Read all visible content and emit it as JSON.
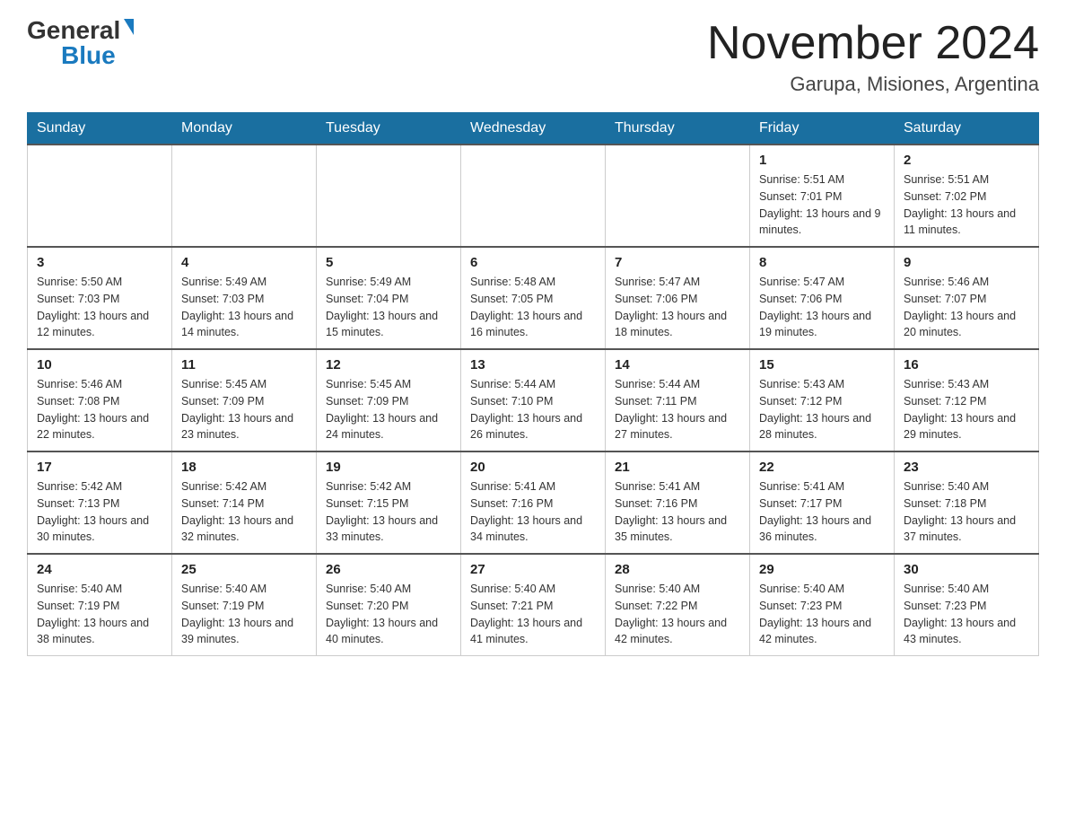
{
  "header": {
    "logo_general": "General",
    "logo_blue": "Blue",
    "month_title": "November 2024",
    "location": "Garupa, Misiones, Argentina"
  },
  "days_of_week": [
    "Sunday",
    "Monday",
    "Tuesday",
    "Wednesday",
    "Thursday",
    "Friday",
    "Saturday"
  ],
  "weeks": [
    [
      {
        "day": "",
        "info": ""
      },
      {
        "day": "",
        "info": ""
      },
      {
        "day": "",
        "info": ""
      },
      {
        "day": "",
        "info": ""
      },
      {
        "day": "",
        "info": ""
      },
      {
        "day": "1",
        "info": "Sunrise: 5:51 AM\nSunset: 7:01 PM\nDaylight: 13 hours and 9 minutes."
      },
      {
        "day": "2",
        "info": "Sunrise: 5:51 AM\nSunset: 7:02 PM\nDaylight: 13 hours and 11 minutes."
      }
    ],
    [
      {
        "day": "3",
        "info": "Sunrise: 5:50 AM\nSunset: 7:03 PM\nDaylight: 13 hours and 12 minutes."
      },
      {
        "day": "4",
        "info": "Sunrise: 5:49 AM\nSunset: 7:03 PM\nDaylight: 13 hours and 14 minutes."
      },
      {
        "day": "5",
        "info": "Sunrise: 5:49 AM\nSunset: 7:04 PM\nDaylight: 13 hours and 15 minutes."
      },
      {
        "day": "6",
        "info": "Sunrise: 5:48 AM\nSunset: 7:05 PM\nDaylight: 13 hours and 16 minutes."
      },
      {
        "day": "7",
        "info": "Sunrise: 5:47 AM\nSunset: 7:06 PM\nDaylight: 13 hours and 18 minutes."
      },
      {
        "day": "8",
        "info": "Sunrise: 5:47 AM\nSunset: 7:06 PM\nDaylight: 13 hours and 19 minutes."
      },
      {
        "day": "9",
        "info": "Sunrise: 5:46 AM\nSunset: 7:07 PM\nDaylight: 13 hours and 20 minutes."
      }
    ],
    [
      {
        "day": "10",
        "info": "Sunrise: 5:46 AM\nSunset: 7:08 PM\nDaylight: 13 hours and 22 minutes."
      },
      {
        "day": "11",
        "info": "Sunrise: 5:45 AM\nSunset: 7:09 PM\nDaylight: 13 hours and 23 minutes."
      },
      {
        "day": "12",
        "info": "Sunrise: 5:45 AM\nSunset: 7:09 PM\nDaylight: 13 hours and 24 minutes."
      },
      {
        "day": "13",
        "info": "Sunrise: 5:44 AM\nSunset: 7:10 PM\nDaylight: 13 hours and 26 minutes."
      },
      {
        "day": "14",
        "info": "Sunrise: 5:44 AM\nSunset: 7:11 PM\nDaylight: 13 hours and 27 minutes."
      },
      {
        "day": "15",
        "info": "Sunrise: 5:43 AM\nSunset: 7:12 PM\nDaylight: 13 hours and 28 minutes."
      },
      {
        "day": "16",
        "info": "Sunrise: 5:43 AM\nSunset: 7:12 PM\nDaylight: 13 hours and 29 minutes."
      }
    ],
    [
      {
        "day": "17",
        "info": "Sunrise: 5:42 AM\nSunset: 7:13 PM\nDaylight: 13 hours and 30 minutes."
      },
      {
        "day": "18",
        "info": "Sunrise: 5:42 AM\nSunset: 7:14 PM\nDaylight: 13 hours and 32 minutes."
      },
      {
        "day": "19",
        "info": "Sunrise: 5:42 AM\nSunset: 7:15 PM\nDaylight: 13 hours and 33 minutes."
      },
      {
        "day": "20",
        "info": "Sunrise: 5:41 AM\nSunset: 7:16 PM\nDaylight: 13 hours and 34 minutes."
      },
      {
        "day": "21",
        "info": "Sunrise: 5:41 AM\nSunset: 7:16 PM\nDaylight: 13 hours and 35 minutes."
      },
      {
        "day": "22",
        "info": "Sunrise: 5:41 AM\nSunset: 7:17 PM\nDaylight: 13 hours and 36 minutes."
      },
      {
        "day": "23",
        "info": "Sunrise: 5:40 AM\nSunset: 7:18 PM\nDaylight: 13 hours and 37 minutes."
      }
    ],
    [
      {
        "day": "24",
        "info": "Sunrise: 5:40 AM\nSunset: 7:19 PM\nDaylight: 13 hours and 38 minutes."
      },
      {
        "day": "25",
        "info": "Sunrise: 5:40 AM\nSunset: 7:19 PM\nDaylight: 13 hours and 39 minutes."
      },
      {
        "day": "26",
        "info": "Sunrise: 5:40 AM\nSunset: 7:20 PM\nDaylight: 13 hours and 40 minutes."
      },
      {
        "day": "27",
        "info": "Sunrise: 5:40 AM\nSunset: 7:21 PM\nDaylight: 13 hours and 41 minutes."
      },
      {
        "day": "28",
        "info": "Sunrise: 5:40 AM\nSunset: 7:22 PM\nDaylight: 13 hours and 42 minutes."
      },
      {
        "day": "29",
        "info": "Sunrise: 5:40 AM\nSunset: 7:23 PM\nDaylight: 13 hours and 42 minutes."
      },
      {
        "day": "30",
        "info": "Sunrise: 5:40 AM\nSunset: 7:23 PM\nDaylight: 13 hours and 43 minutes."
      }
    ]
  ]
}
